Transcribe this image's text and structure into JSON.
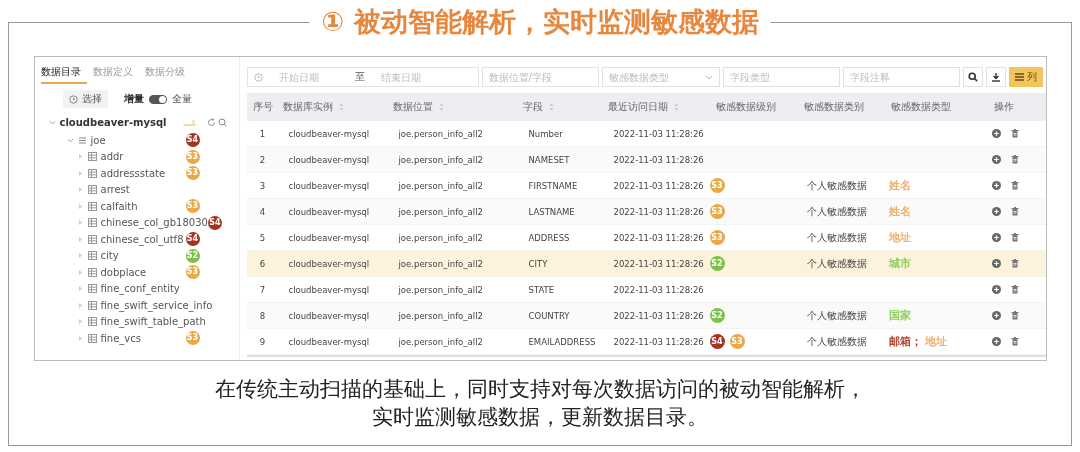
{
  "slide_title": "① 被动智能解析，实时监测敏感数据",
  "sidebar": {
    "tabs": [
      {
        "label": "数据目录",
        "selected": true
      },
      {
        "label": "数据定义",
        "selected": false
      },
      {
        "label": "数据分级",
        "selected": false
      }
    ],
    "select_button": "选择",
    "mode_left": "增量",
    "mode_toggle_on": true,
    "mode_right": "全量",
    "tree": [
      {
        "label": "cloudbeaver-mysql",
        "expanded": true,
        "children": [
          {
            "label": "joe",
            "expanded": true,
            "level": "S4",
            "color": "#a83222",
            "children": [
              {
                "label": "addr",
                "expanded": false,
                "level": "S3",
                "color": "#e9a948"
              },
              {
                "label": "addressstate",
                "expanded": false,
                "level": "S3",
                "color": "#e9a948"
              },
              {
                "label": "arrest",
                "expanded": false
              },
              {
                "label": "calfaith",
                "expanded": false,
                "level": "S3",
                "color": "#e9a948"
              },
              {
                "label": "chinese_col_gb18030",
                "expanded": false,
                "level": "S4",
                "color": "#a83222"
              },
              {
                "label": "chinese_col_utf8",
                "expanded": false,
                "level": "S4",
                "color": "#a83222"
              },
              {
                "label": "city",
                "expanded": false,
                "level": "S2",
                "color": "#7cc24a"
              },
              {
                "label": "dobplace",
                "expanded": false,
                "level": "S3",
                "color": "#e9a948"
              },
              {
                "label": "fine_conf_entity",
                "expanded": false
              },
              {
                "label": "fine_swift_service_info",
                "expanded": false
              },
              {
                "label": "fine_swift_table_path",
                "expanded": false
              },
              {
                "label": "fine_vcs",
                "expanded": false,
                "level": "S3",
                "color": "#e9a948"
              }
            ]
          }
        ]
      }
    ]
  },
  "filters": {
    "start_date": {
      "placeholder": "开始日期"
    },
    "range_sep": "至",
    "end_date": {
      "placeholder": "结束日期"
    },
    "location": {
      "placeholder": "数据位置/字段"
    },
    "type_select": {
      "placeholder": "敏感数据类型"
    },
    "field_type": {
      "placeholder": "字段类型"
    },
    "field_comment": {
      "placeholder": "字段注释"
    },
    "columns_button": "列"
  },
  "table": {
    "columns": [
      {
        "label": "序号",
        "sortable": false
      },
      {
        "label": "数据库实例",
        "sortable": true
      },
      {
        "label": "数据位置",
        "sortable": true
      },
      {
        "label": "字段",
        "sortable": true
      },
      {
        "label": "最近访问日期",
        "sortable": true
      },
      {
        "label": "敏感数据级别",
        "sortable": false
      },
      {
        "label": "敏感数据类别",
        "sortable": false
      },
      {
        "label": "敏感数据类型",
        "sortable": false
      },
      {
        "label": "操作",
        "sortable": false
      }
    ],
    "rows": [
      {
        "no": "1",
        "instance": "cloudbeaver-mysql",
        "location": "joe.person_info_all2",
        "field": "Number",
        "date": "2022-11-03 11:28:26",
        "selected": false,
        "levels": [],
        "category": "",
        "types": []
      },
      {
        "no": "2",
        "instance": "cloudbeaver-mysql",
        "location": "joe.person_info_all2",
        "field": "NAMESET",
        "date": "2022-11-03 11:28:26",
        "selected": false,
        "levels": [],
        "category": "",
        "types": []
      },
      {
        "no": "3",
        "instance": "cloudbeaver-mysql",
        "location": "joe.person_info_all2",
        "field": "FIRSTNAME",
        "date": "2022-11-03 11:28:26",
        "selected": false,
        "levels": [
          {
            "label": "S3",
            "color": "#e9a948"
          }
        ],
        "category": "个人敏感数据",
        "types": [
          {
            "label": "姓名",
            "color": "#f0b072"
          }
        ]
      },
      {
        "no": "4",
        "instance": "cloudbeaver-mysql",
        "location": "joe.person_info_all2",
        "field": "LASTNAME",
        "date": "2022-11-03 11:28:26",
        "selected": false,
        "levels": [
          {
            "label": "S3",
            "color": "#e9a948"
          }
        ],
        "category": "个人敏感数据",
        "types": [
          {
            "label": "姓名",
            "color": "#f0b072"
          }
        ]
      },
      {
        "no": "5",
        "instance": "cloudbeaver-mysql",
        "location": "joe.person_info_all2",
        "field": "ADDRESS",
        "date": "2022-11-03 11:28:26",
        "selected": false,
        "levels": [
          {
            "label": "S3",
            "color": "#e9a948"
          }
        ],
        "category": "个人敏感数据",
        "types": [
          {
            "label": "地址",
            "color": "#f0b072"
          }
        ]
      },
      {
        "no": "6",
        "instance": "cloudbeaver-mysql",
        "location": "joe.person_info_all2",
        "field": "CITY",
        "date": "2022-11-03 11:28:26",
        "selected": true,
        "levels": [
          {
            "label": "S2",
            "color": "#7cc24a"
          }
        ],
        "category": "个人敏感数据",
        "types": [
          {
            "label": "城市",
            "color": "#8fce5c"
          }
        ]
      },
      {
        "no": "7",
        "instance": "cloudbeaver-mysql",
        "location": "joe.person_info_all2",
        "field": "STATE",
        "date": "2022-11-03 11:28:26",
        "selected": false,
        "levels": [],
        "category": "",
        "types": []
      },
      {
        "no": "8",
        "instance": "cloudbeaver-mysql",
        "location": "joe.person_info_all2",
        "field": "COUNTRY",
        "date": "2022-11-03 11:28:26",
        "selected": false,
        "levels": [
          {
            "label": "S2",
            "color": "#7cc24a"
          }
        ],
        "category": "个人敏感数据",
        "types": [
          {
            "label": "国家",
            "color": "#8fce5c"
          }
        ]
      },
      {
        "no": "9",
        "instance": "cloudbeaver-mysql",
        "location": "joe.person_info_all2",
        "field": "EMAILADDRESS",
        "date": "2022-11-03 11:28:26",
        "selected": false,
        "levels": [
          {
            "label": "S4",
            "color": "#a83222"
          },
          {
            "label": "S3",
            "color": "#e9a948"
          }
        ],
        "category": "个人敏感数据",
        "types": [
          {
            "label": "邮箱；",
            "color": "#b0402e"
          },
          {
            "label": "地址",
            "color": "#f0b072"
          }
        ]
      }
    ]
  },
  "caption": [
    "在传统主动扫描的基础上，同时支持对每次数据访问的被动智能解析，",
    "实时监测敏感数据，更新数据目录。"
  ]
}
